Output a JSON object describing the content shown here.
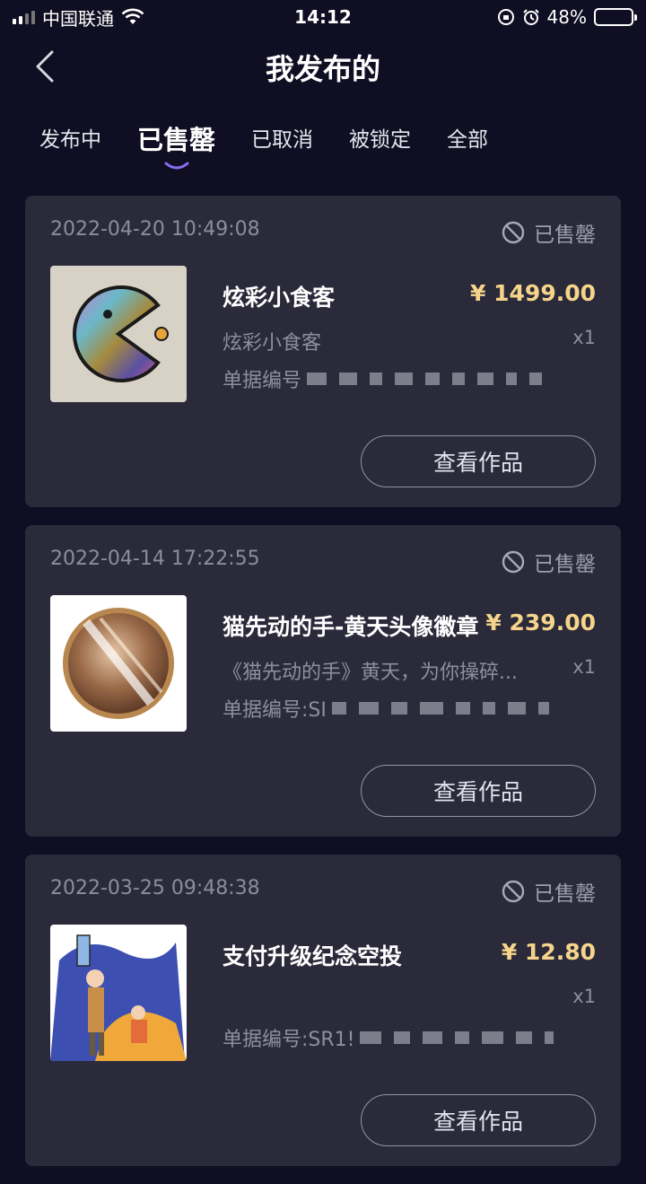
{
  "status_bar": {
    "carrier": "中国联通",
    "time": "14:12",
    "battery": "48%",
    "battery_level": 0.48
  },
  "nav": {
    "title": "我发布的",
    "back_icon": "chevron-left-icon"
  },
  "tabs": [
    {
      "label": "发布中",
      "active": false
    },
    {
      "label": "已售罄",
      "active": true
    },
    {
      "label": "已取消",
      "active": false
    },
    {
      "label": "被锁定",
      "active": false
    },
    {
      "label": "全部",
      "active": false
    }
  ],
  "orders": [
    {
      "time": "2022-04-20 10:49:08",
      "status": "已售罄",
      "name": "炫彩小食客",
      "price": "¥ 1499.00",
      "subtitle": "炫彩小食客",
      "qty": "x1",
      "order_no": "单据编号",
      "button": "查看作品"
    },
    {
      "time": "2022-04-14 17:22:55",
      "status": "已售罄",
      "name": "猫先动的手-黄天头像徽章",
      "price": "¥ 239.00",
      "subtitle": "《猫先动的手》黄天，为你操碎...",
      "qty": "x1",
      "order_no": "单据编号:SI",
      "button": "查看作品"
    },
    {
      "time": "2022-03-25 09:48:38",
      "status": "已售罄",
      "name": "支付升级纪念空投",
      "price": "¥ 12.80",
      "subtitle": "",
      "qty": "x1",
      "order_no": "单据编号:SR1!",
      "button": "查看作品"
    }
  ],
  "colors": {
    "background": "#0f0e22",
    "card": "#2b2a3b",
    "price": "#f6d58a",
    "tab_indicator": "#8a6cf0"
  }
}
